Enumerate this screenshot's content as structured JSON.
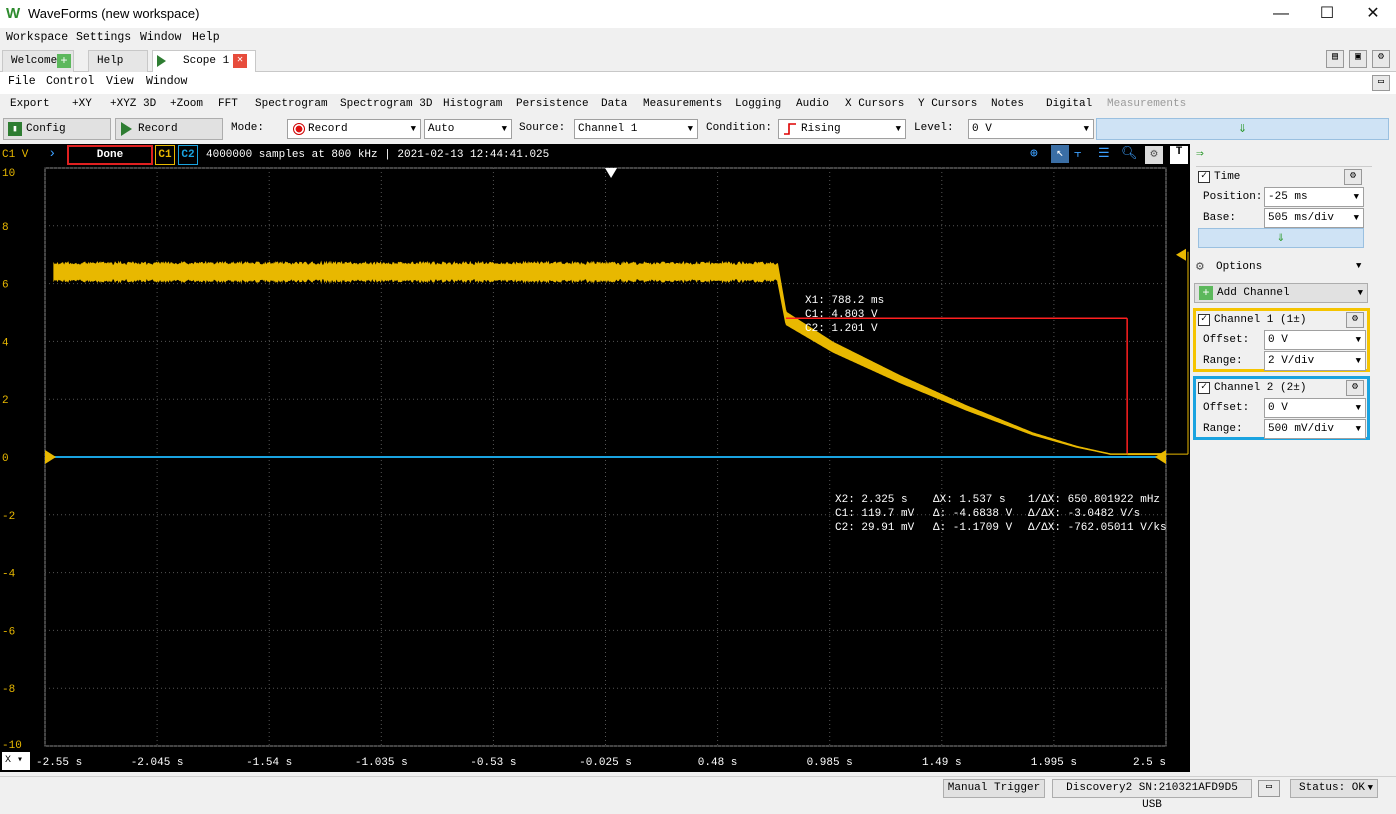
{
  "window": {
    "title": "WaveForms (new workspace)",
    "minimize": "—",
    "maximize": "☐",
    "close": "✕"
  },
  "main_menu": [
    "Workspace",
    "Settings",
    "Window",
    "Help"
  ],
  "tabs": {
    "welcome": "Welcome",
    "help": "Help",
    "scope": "Scope 1"
  },
  "instrument_menu": [
    "File",
    "Control",
    "View",
    "Window"
  ],
  "toolbar": [
    "Export",
    "+XY",
    "+XYZ 3D",
    "+Zoom",
    "FFT",
    "Spectrogram",
    "Spectrogram 3D",
    "Histogram",
    "Persistence",
    "Data",
    "Measurements",
    "Logging",
    "Audio",
    "X Cursors",
    "Y Cursors",
    "Notes",
    "Digital",
    "Measurements"
  ],
  "controls": {
    "config": "Config",
    "record_btn": "Record",
    "mode_label": "Mode:",
    "mode": "Record",
    "mode2": "Auto",
    "source_label": "Source:",
    "source": "Channel 1",
    "condition_label": "Condition:",
    "condition": "Rising",
    "level_label": "Level:",
    "level": "0 V"
  },
  "plot_status": {
    "axis_unit": "C1 V",
    "state": "Done",
    "c1": "C1",
    "c2": "C2",
    "info": "4000000 samples at 800 kHz | 2021-02-13 12:44:41.025"
  },
  "y_ticks": [
    "10",
    "8",
    "6",
    "4",
    "2",
    "0",
    "-2",
    "-4",
    "-6",
    "-8",
    "-10"
  ],
  "x_ticks": [
    "-2.55 s",
    "-2.045 s",
    "-1.54 s",
    "-1.035 s",
    "-0.53 s",
    "-0.025 s",
    "0.48 s",
    "0.985 s",
    "1.49 s",
    "1.995 s",
    "2.5 s"
  ],
  "cursor1": {
    "x": "X1: 788.2 ms",
    "c1": "C1: 4.803 V",
    "c2": "C2: 1.201 V"
  },
  "cursor2": {
    "col1": [
      "X2: 2.325 s",
      "C1: 119.7 mV",
      "C2: 29.91 mV"
    ],
    "col2": [
      "ΔX: 1.537 s",
      "Δ: -4.6838 V",
      "Δ: -1.1709 V"
    ],
    "col3": [
      "1/ΔX: 650.801922 mHz",
      "Δ/ΔX: -3.0482 V/s",
      "Δ/ΔX: -762.05011 V/ks"
    ]
  },
  "right_panel": {
    "time_title": "Time",
    "position_label": "Position:",
    "position": "-25 ms",
    "base_label": "Base:",
    "base": "505 ms/div",
    "options": "Options",
    "add_channel": "Add Channel",
    "ch1_title": "Channel 1 (1±)",
    "ch1_offset_label": "Offset:",
    "ch1_offset": "0 V",
    "ch1_range_label": "Range:",
    "ch1_range": "2 V/div",
    "ch2_title": "Channel 2 (2±)",
    "ch2_offset_label": "Offset:",
    "ch2_offset": "0 V",
    "ch2_range_label": "Range:",
    "ch2_range": "500 mV/div"
  },
  "statusbar": {
    "manual_trigger": "Manual Trigger",
    "device": "Discovery2 SN:210321AFD9D5 USB",
    "status": "Status: OK"
  },
  "colors": {
    "ch1": "#e8b800",
    "ch2": "#1aa3e0",
    "cursor": "#ff2020",
    "plot_bg": "#000000",
    "grid": "#555555"
  },
  "chart_data": {
    "type": "line",
    "title": "",
    "xlabel": "",
    "ylabel": "C1 V",
    "xlim": [
      -2.55,
      2.5
    ],
    "ylim": [
      -10,
      10
    ],
    "grid": true,
    "series": [
      {
        "name": "C1",
        "x": [
          -2.55,
          -2.3,
          -1.5,
          -0.5,
          0.5,
          0.7,
          0.75,
          0.788,
          1.0,
          1.3,
          1.6,
          1.9,
          2.1,
          2.25,
          2.325,
          2.5
        ],
        "y": [
          6.4,
          6.4,
          6.4,
          6.4,
          6.4,
          6.4,
          6.4,
          4.8,
          3.8,
          2.7,
          1.7,
          0.8,
          0.35,
          0.1,
          0.1,
          0.1
        ]
      },
      {
        "name": "C2",
        "x": [
          -2.55,
          2.5
        ],
        "y": [
          0.0,
          0.0
        ]
      }
    ],
    "cursors": [
      {
        "name": "X1",
        "x": 0.788,
        "y": 4.803
      },
      {
        "name": "X2",
        "x": 2.325,
        "y": 0.1197
      }
    ]
  }
}
